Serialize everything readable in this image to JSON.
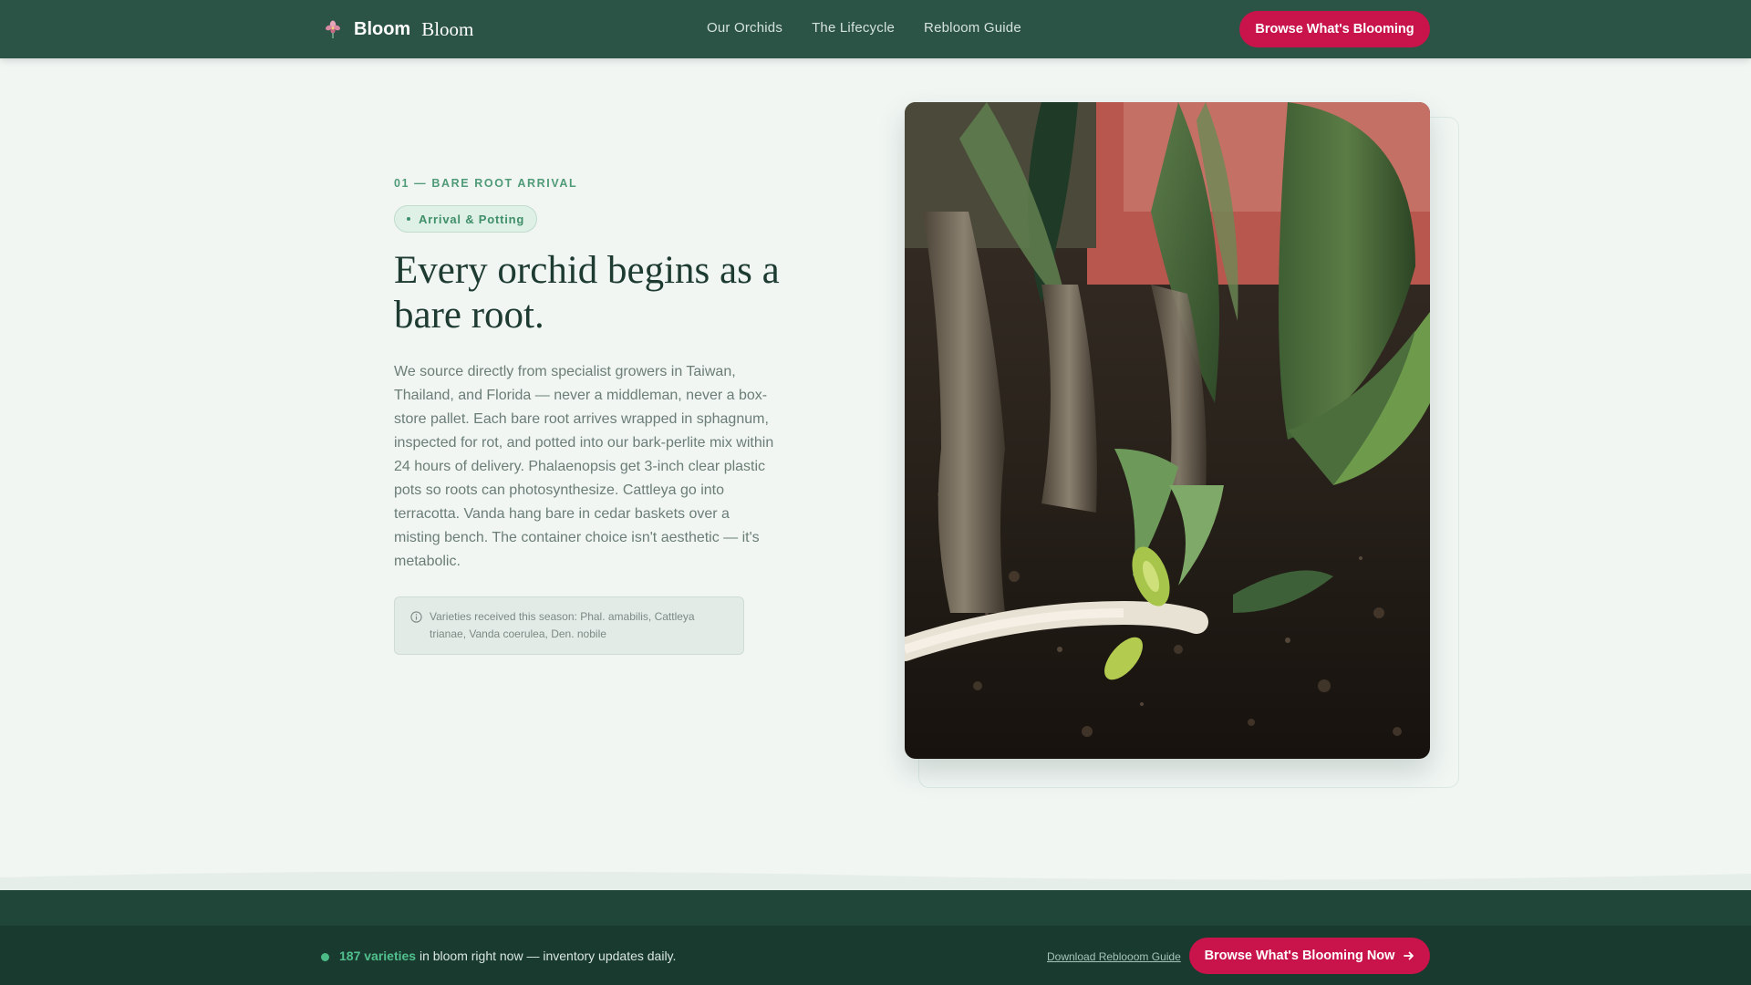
{
  "header": {
    "brand_name": "Bloom",
    "brand_subtitle": "Bloom",
    "logo_icon": "orchid-flower-icon",
    "nav": [
      {
        "label": "Our Orchids"
      },
      {
        "label": "The Lifecycle"
      },
      {
        "label": "Rebloom Guide"
      }
    ],
    "cta_label": "Browse What's Blooming"
  },
  "hero": {
    "eyebrow": "01 — BARE ROOT ARRIVAL",
    "stage_chip": "Arrival & Potting",
    "headline": "Every orchid begins as a bare root.",
    "body": "We source directly from specialist growers in Taiwan, Thailand, and Florida — never a middleman, never a box-store pallet. Each bare root arrives wrapped in sphagnum, inspected for rot, and potted into our bark-perlite mix within 24 hours of delivery. Phalaenopsis get 3-inch clear plastic pots so roots can photosynthesize. Cattleya go into terracotta. Vanda hang bare in cedar baskets over a misting bench. The container choice isn't aesthetic — it's metabolic.",
    "info_icon": "info-circle-icon",
    "info_text": "Varieties received this season: Phal. amabilis, Cattleya trianae, Vanda coerulea, Den. nobile"
  },
  "photo": {
    "subject": "close-up photo of orchid plant base with new green root tips in dark potting soil"
  },
  "footer_bar": {
    "count_text": "187 varieties",
    "status_text": " in bloom right now — inventory updates daily.",
    "guide_link": "Download Reblooom Guide",
    "cta_label": "Browse What's Blooming Now",
    "cta_icon": "arrow-right-icon"
  },
  "colors": {
    "header_bg": "#2c5446",
    "accent": "#c8134b",
    "green_accent": "#4f9a77",
    "page_bg": "#f1f6f3",
    "footer_bg": "#183a2f"
  }
}
